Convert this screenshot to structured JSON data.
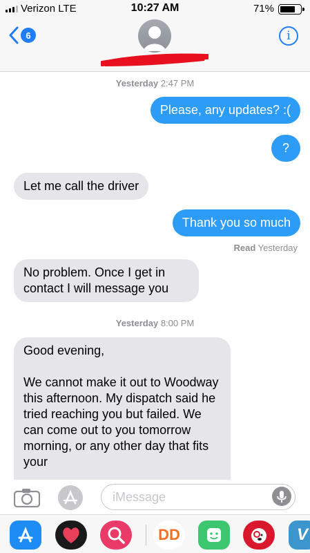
{
  "status_bar": {
    "carrier": "Verizon  LTE",
    "time": "10:27 AM",
    "battery": "71%"
  },
  "header": {
    "back_count": "6",
    "info_glyph": "i",
    "avatar_icon": "person-silhouette-icon"
  },
  "conversation": {
    "timestamp_1": {
      "day": "Yesterday",
      "time": "2:47 PM"
    },
    "timestamp_2": {
      "day": "Yesterday",
      "time": "8:00 PM"
    },
    "messages": [
      {
        "from": "me",
        "text": "Please, any updates? :("
      },
      {
        "from": "me",
        "text": "?"
      },
      {
        "from": "them",
        "text": "Let me call the driver"
      },
      {
        "from": "me",
        "text": "Thank you so much"
      },
      {
        "from": "them",
        "text": "No problem. Once I get in contact I will message you"
      },
      {
        "from": "them",
        "text": "Good evening,\n\nWe cannot make it out to Woodway this afternoon. My dispatch said he tried reaching you but failed. We can come out to you tomorrow morning, or any other day that fits your"
      }
    ],
    "read_receipt": {
      "label": "Read",
      "when": "Yesterday"
    }
  },
  "compose": {
    "placeholder": "iMessage"
  },
  "app_drawer": {
    "apps": [
      "app-store-icon",
      "heart-photos-icon",
      "web-search-icon",
      "dunkin-dd-icon",
      "bitmoji-icon",
      "target-bullseye-dog-icon",
      "venmo-v-icon"
    ],
    "dunkin_label": "DD",
    "venmo_label": "V"
  },
  "colors": {
    "outgoing_bubble": "#2d9cf7",
    "incoming_bubble": "#e5e5ea",
    "accent": "#1f7ef6",
    "redaction": "#e8101e"
  }
}
